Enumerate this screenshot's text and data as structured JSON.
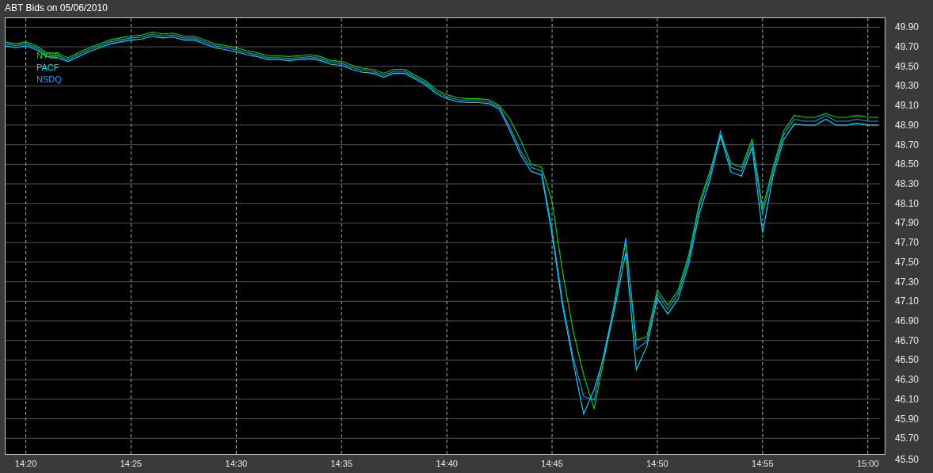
{
  "window": {
    "title": "ABT Bids on 05/06/2010"
  },
  "chart_data": {
    "type": "line",
    "categories": [
      null,
      null,
      "14:20",
      null,
      null,
      null,
      null,
      null,
      null,
      null,
      null,
      null,
      "14:25",
      null,
      null,
      null,
      null,
      null,
      null,
      null,
      null,
      null,
      "14:30",
      null,
      null,
      null,
      null,
      null,
      null,
      null,
      null,
      null,
      "14:35",
      null,
      null,
      null,
      null,
      null,
      null,
      null,
      null,
      null,
      "14:40",
      null,
      null,
      null,
      null,
      null,
      null,
      null,
      null,
      null,
      "14:45",
      null,
      null,
      null,
      null,
      null,
      null,
      null,
      null,
      null,
      "14:50",
      null,
      null,
      null,
      null,
      null,
      null,
      null,
      null,
      null,
      "14:55",
      null,
      null,
      null,
      null,
      null,
      null,
      null,
      null,
      null,
      "15:00",
      null
    ],
    "series": [
      {
        "name": "NYSE",
        "color": "#00e000",
        "values": [
          49.75,
          49.73,
          49.75,
          49.71,
          49.64,
          49.63,
          49.59,
          49.64,
          49.69,
          49.73,
          49.77,
          49.79,
          49.81,
          49.82,
          49.85,
          49.83,
          49.84,
          49.81,
          49.81,
          49.77,
          49.73,
          49.71,
          49.69,
          49.66,
          49.64,
          49.61,
          49.61,
          49.6,
          49.61,
          49.62,
          49.6,
          49.56,
          49.55,
          49.51,
          49.48,
          49.47,
          49.43,
          49.47,
          49.47,
          49.41,
          49.35,
          49.26,
          49.21,
          49.18,
          49.17,
          49.17,
          49.16,
          49.1,
          48.96,
          48.75,
          48.5,
          48.47,
          48.12,
          47.4,
          46.8,
          46.35,
          46.0,
          46.55,
          47.14,
          47.7,
          46.7,
          46.74,
          47.22,
          47.06,
          47.22,
          47.58,
          48.11,
          48.43,
          48.8,
          48.51,
          48.47,
          48.76,
          48.05,
          48.47,
          48.84,
          49.0,
          48.98,
          48.98,
          49.02,
          48.98,
          48.98,
          49.0,
          48.98,
          48.98
        ]
      },
      {
        "name": "PACF",
        "color": "#00e5ff",
        "values": [
          49.71,
          49.69,
          49.71,
          49.67,
          49.6,
          49.59,
          49.55,
          49.6,
          49.65,
          49.69,
          49.73,
          49.75,
          49.77,
          49.78,
          49.81,
          49.79,
          49.8,
          49.77,
          49.77,
          49.73,
          49.69,
          49.67,
          49.65,
          49.62,
          49.6,
          49.57,
          49.57,
          49.56,
          49.57,
          49.58,
          49.56,
          49.52,
          49.51,
          49.47,
          49.44,
          49.43,
          49.39,
          49.43,
          49.43,
          49.37,
          49.31,
          49.22,
          49.17,
          49.14,
          49.13,
          49.13,
          49.12,
          49.06,
          48.84,
          48.6,
          48.43,
          48.39,
          47.78,
          47.05,
          46.48,
          45.95,
          46.2,
          46.56,
          47.05,
          47.6,
          46.4,
          46.64,
          47.13,
          46.97,
          47.13,
          47.49,
          48.0,
          48.34,
          48.79,
          48.42,
          48.38,
          48.67,
          47.8,
          48.38,
          48.75,
          48.91,
          48.9,
          48.9,
          48.96,
          48.9,
          48.9,
          48.92,
          48.9,
          48.9
        ]
      },
      {
        "name": "NSDQ",
        "color": "#1e9bff",
        "values": [
          49.73,
          49.71,
          49.73,
          49.69,
          49.62,
          49.61,
          49.57,
          49.62,
          49.67,
          49.71,
          49.75,
          49.77,
          49.79,
          49.8,
          49.83,
          49.81,
          49.82,
          49.79,
          49.79,
          49.75,
          49.71,
          49.69,
          49.67,
          49.64,
          49.62,
          49.59,
          49.59,
          49.58,
          49.59,
          49.6,
          49.58,
          49.54,
          49.53,
          49.49,
          49.46,
          49.45,
          49.41,
          49.45,
          49.45,
          49.39,
          49.33,
          49.24,
          49.19,
          49.16,
          49.15,
          49.15,
          49.14,
          49.08,
          48.88,
          48.64,
          48.47,
          48.43,
          47.83,
          47.1,
          46.53,
          46.13,
          46.09,
          46.61,
          47.1,
          47.75,
          46.61,
          46.69,
          47.18,
          47.02,
          47.18,
          47.54,
          48.07,
          48.39,
          48.84,
          48.47,
          48.43,
          48.72,
          47.99,
          48.43,
          48.8,
          48.96,
          48.94,
          48.94,
          49.0,
          48.94,
          48.94,
          48.96,
          48.94,
          48.94
        ]
      }
    ],
    "ylim": [
      45.5,
      50.0
    ],
    "grid": true,
    "yticks": [
      {
        "value": 45.5,
        "label": "45.50"
      },
      {
        "value": 45.7,
        "label": "45.70"
      },
      {
        "value": 45.9,
        "label": "45.90"
      },
      {
        "value": 46.1,
        "label": "46.10"
      },
      {
        "value": 46.3,
        "label": "46.30"
      },
      {
        "value": 46.5,
        "label": "46.50"
      },
      {
        "value": 46.7,
        "label": "46.70"
      },
      {
        "value": 46.9,
        "label": "46.90"
      },
      {
        "value": 47.1,
        "label": "47.10"
      },
      {
        "value": 47.3,
        "label": "47.30"
      },
      {
        "value": 47.5,
        "label": "47.50"
      },
      {
        "value": 47.7,
        "label": "47.70"
      },
      {
        "value": 47.9,
        "label": "47.90"
      },
      {
        "value": 48.1,
        "label": "48.10"
      },
      {
        "value": 48.3,
        "label": "48.30"
      },
      {
        "value": 48.5,
        "label": "48.50"
      },
      {
        "value": 48.7,
        "label": "48.70"
      },
      {
        "value": 48.9,
        "label": "48.90"
      },
      {
        "value": 49.1,
        "label": "49.10"
      },
      {
        "value": 49.3,
        "label": "49.30"
      },
      {
        "value": 49.5,
        "label": "49.50"
      },
      {
        "value": 49.7,
        "label": "49.70"
      },
      {
        "value": 49.9,
        "label": "49.90"
      }
    ]
  }
}
